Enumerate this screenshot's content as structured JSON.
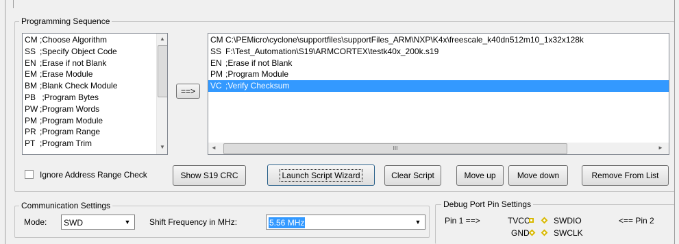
{
  "programming_sequence": {
    "title": "Programming Sequence",
    "commands": [
      {
        "code": "CM",
        "desc": ";Choose Algorithm"
      },
      {
        "code": "SS",
        "desc": ";Specify Object Code"
      },
      {
        "code": "EN",
        "desc": ";Erase if not Blank"
      },
      {
        "code": "EM",
        "desc": ";Erase Module"
      },
      {
        "code": "BM",
        "desc": ";Blank Check Module"
      },
      {
        "code": "PB",
        "desc": " ;Program Bytes"
      },
      {
        "code": "PW",
        "desc": ";Program Words"
      },
      {
        "code": "PM",
        "desc": ";Program Module"
      },
      {
        "code": "PR",
        "desc": ";Program Range"
      },
      {
        "code": "PT",
        "desc": ";Program Trim"
      }
    ],
    "add_button": "==>",
    "script_lines": [
      {
        "code": "CM",
        "desc": "C:\\PEMicro\\cyclone\\supportfiles\\supportFiles_ARM\\NXP\\K4x\\freescale_k40dn512m10_1x32x128k"
      },
      {
        "code": "SS",
        "desc": "F:\\Test_Automation\\S19\\ARMCORTEX\\testk40x_200k.s19"
      },
      {
        "code": "EN",
        "desc": ";Erase if not Blank"
      },
      {
        "code": "PM",
        "desc": ";Program Module"
      },
      {
        "code": "VC",
        "desc": ";Verify Checksum",
        "selected": true
      }
    ],
    "scroll_thumb_glyph": "III",
    "ignore_range_label": "Ignore Address Range Check",
    "ignore_range_checked": false,
    "buttons": {
      "show_crc": "Show S19 CRC",
      "launch_wizard": "Launch Script  Wizard",
      "clear_script": "Clear Script",
      "move_up": "Move up",
      "move_down": "Move down",
      "remove": "Remove From List"
    }
  },
  "communication": {
    "title": "Communication Settings",
    "mode_label": "Mode:",
    "mode_value": "SWD",
    "freq_label": "Shift Frequency in MHz:",
    "freq_value": "5.56 MHz"
  },
  "debug_port": {
    "title": "Debug Port Pin Settings",
    "pin1_label": "Pin 1 ==>",
    "row1": {
      "left": "TVCC",
      "right": "SWDIO"
    },
    "pin2_label": "<== Pin 2",
    "row2": {
      "left": "GND",
      "right": "SWCLK"
    },
    "pin_color": "#d8b800"
  },
  "colors": {
    "selection": "#3399ff"
  }
}
